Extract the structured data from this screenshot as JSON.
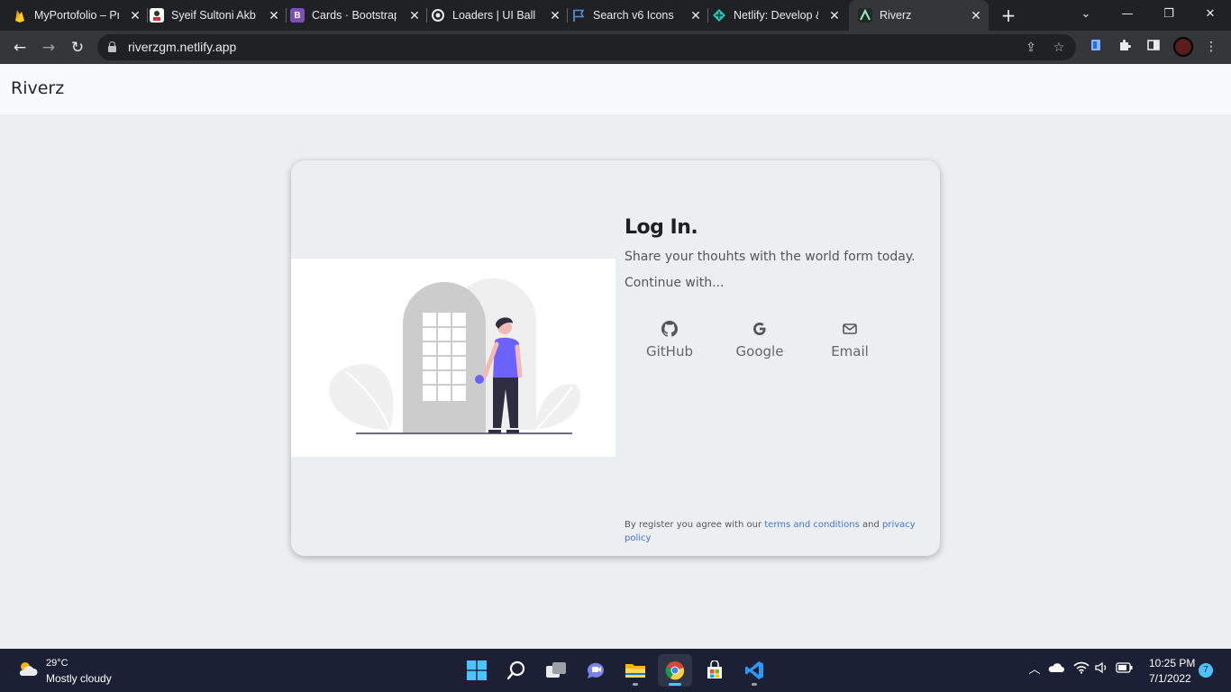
{
  "browser": {
    "tabs": [
      {
        "title": "MyPortofolio – Pr",
        "icon": "firebase-icon",
        "color": "#f5a623"
      },
      {
        "title": "Syeif Sultoni Akba",
        "icon": "profile-favicon",
        "color": "#ffffff"
      },
      {
        "title": "Cards · Bootstrap",
        "icon": "bootstrap-icon",
        "color": "#7952b3"
      },
      {
        "title": "Loaders | UI Ball",
        "icon": "uiball-icon",
        "color": "#e8eaed"
      },
      {
        "title": "Search v6 Icons |",
        "icon": "fontawesome-flag-icon",
        "color": "#528dd7"
      },
      {
        "title": "Netlify: Develop &",
        "icon": "netlify-icon",
        "color": "#20c6b7"
      },
      {
        "title": "Riverz",
        "icon": "riverz-favicon",
        "color": "#1e2a24"
      }
    ],
    "new_tab": "+",
    "url": "riverzgm.netlify.app"
  },
  "navbar": {
    "brand": "Riverz"
  },
  "login": {
    "title": "Log In.",
    "subtitle": "Share your thouhts with the world form today.",
    "continue": "Continue with...",
    "providers": [
      {
        "label": "GitHub",
        "icon": "github-icon"
      },
      {
        "label": "Google",
        "icon": "google-icon"
      },
      {
        "label": "Email",
        "icon": "envelope-icon"
      }
    ],
    "terms": {
      "prefix": "By register you agree with our ",
      "terms_link": "terms and conditions",
      "middle": " and ",
      "privacy_link": "privacy policy"
    }
  },
  "taskbar": {
    "weather": {
      "temp": "29°C",
      "desc": "Mostly cloudy"
    },
    "apps": [
      "start",
      "search",
      "task-view",
      "chat",
      "file-explorer",
      "chrome",
      "microsoft-store",
      "vscode"
    ],
    "time": "10:25 PM",
    "date": "7/1/2022",
    "notifications": "7"
  },
  "colors": {
    "accent_purple": "#6c63ff",
    "link": "#4a6fd6",
    "page_bg": "#eceff1"
  }
}
